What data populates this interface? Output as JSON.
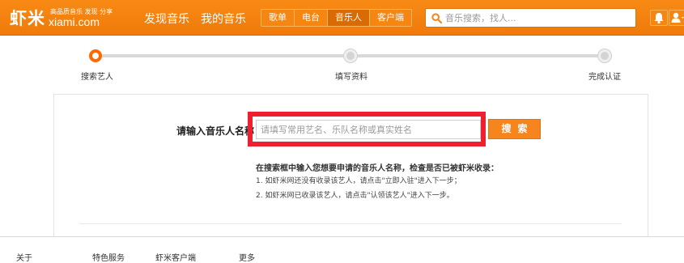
{
  "header": {
    "logo_text": "虾米",
    "logo_domain": "xiami.com",
    "logo_tagline": "高品质音乐 发现 分享",
    "nav": [
      "发现音乐",
      "我的音乐"
    ],
    "tabs": [
      {
        "label": "歌单",
        "active": false
      },
      {
        "label": "电台",
        "active": false
      },
      {
        "label": "音乐人",
        "active": true
      },
      {
        "label": "客户端",
        "active": false
      }
    ],
    "search_placeholder": "音乐搜索，找人...",
    "accent_color": "#f7851e"
  },
  "steps": [
    {
      "label": "搜索艺人",
      "active": true
    },
    {
      "label": "填写资料",
      "active": false
    },
    {
      "label": "完成认证",
      "active": false
    }
  ],
  "form": {
    "label": "请输入音乐人名称",
    "input_placeholder": "请填写常用艺名、乐队名称或真实姓名",
    "search_button": "搜索",
    "highlight_color": "#ee1f2f"
  },
  "instructions": {
    "title": "在搜索框中输入您想要申请的音乐人名称，检查是否已被虾米收录：",
    "lines": [
      "1. 如虾米网还没有收录该艺人，请点击\"立即入驻\"进入下一步；",
      "2. 如虾米网已收录该艺人，请点击\"认领该艺人\"进入下一步。"
    ]
  },
  "footer": {
    "links": [
      "关于",
      "特色服务",
      "虾米客户端",
      "更多"
    ]
  }
}
